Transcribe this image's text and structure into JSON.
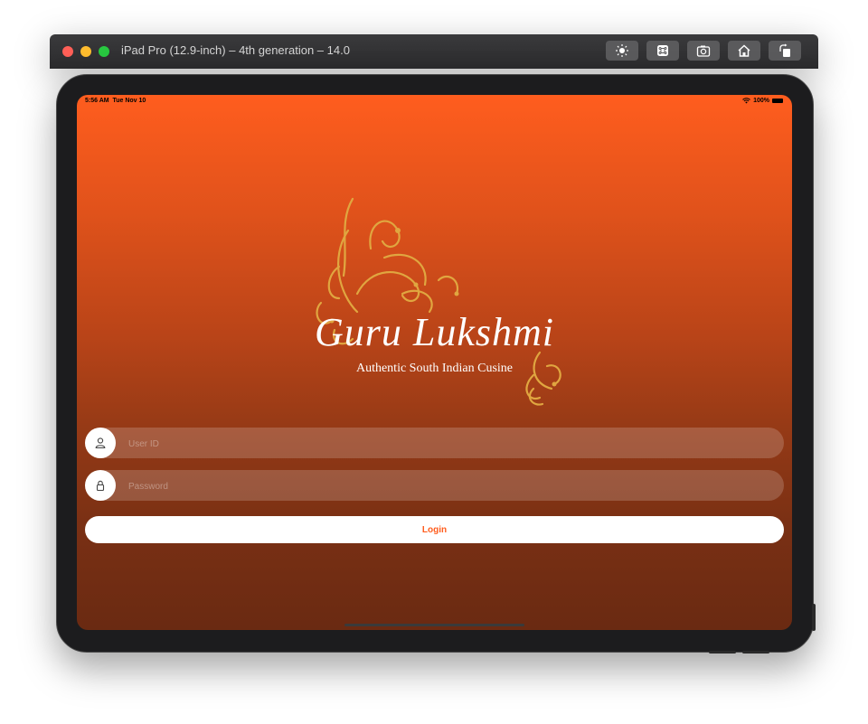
{
  "window": {
    "title": "iPad Pro (12.9-inch) – 4th generation – 14.0"
  },
  "toolbar": {
    "buttons": [
      {
        "name": "brightness-icon"
      },
      {
        "name": "command-icon"
      },
      {
        "name": "screenshot-icon"
      },
      {
        "name": "home-icon"
      },
      {
        "name": "rotate-icon"
      }
    ]
  },
  "status_bar": {
    "time": "5:56 AM",
    "date": "Tue Nov 10",
    "battery": "100%"
  },
  "brand": {
    "name": "Guru Lukshmi",
    "tagline": "Authentic South Indian Cusine"
  },
  "form": {
    "user_placeholder": "User ID",
    "password_placeholder": "Password",
    "login_label": "Login"
  },
  "colors": {
    "accent": "#ff5d1e",
    "gradient_top": "#ff5d1e",
    "gradient_bottom": "#6a2a12",
    "ornament": "#e0a640"
  }
}
